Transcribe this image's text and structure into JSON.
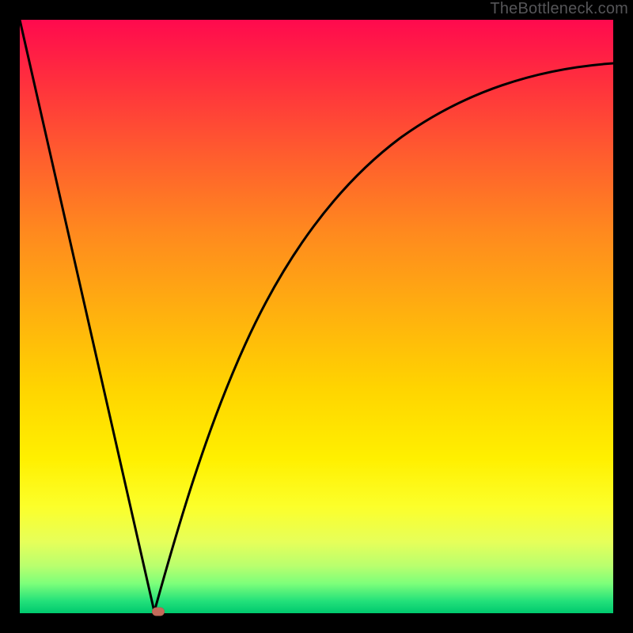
{
  "watermark": "TheBottleneck.com",
  "colors": {
    "frame": "#000000",
    "curve": "#000000",
    "marker": "#c46a5a",
    "gradient_top": "#ff0a4e",
    "gradient_bottom": "#00c96e"
  },
  "chart_data": {
    "type": "line",
    "title": "",
    "xlabel": "",
    "ylabel": "",
    "xlim": [
      0,
      100
    ],
    "ylim": [
      0,
      100
    ],
    "grid": false,
    "legend": false,
    "annotations": [
      {
        "kind": "marker",
        "x": 23,
        "y": 0
      }
    ],
    "series": [
      {
        "name": "left-slope",
        "x": [
          0,
          22.5
        ],
        "values": [
          100,
          0
        ]
      },
      {
        "name": "right-curve",
        "x": [
          22.5,
          25,
          28,
          32,
          37,
          43,
          50,
          58,
          67,
          77,
          88,
          100
        ],
        "values": [
          0,
          18,
          34,
          48,
          59,
          68,
          75,
          80,
          84,
          87,
          89,
          91
        ]
      }
    ]
  }
}
